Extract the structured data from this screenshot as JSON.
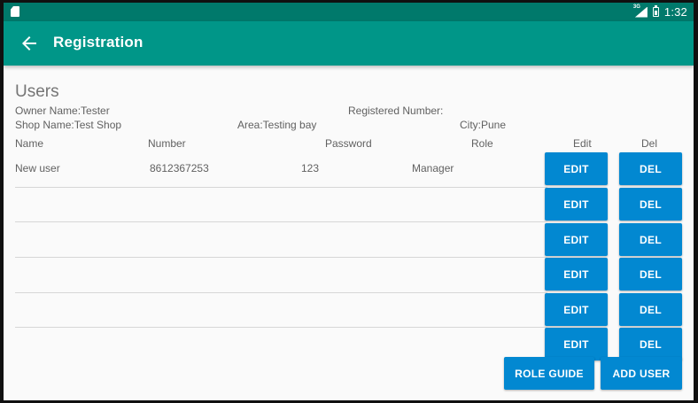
{
  "status_bar": {
    "network": "3G",
    "time": "1:32"
  },
  "app_bar": {
    "title": "Registration"
  },
  "section": {
    "title": "Users"
  },
  "shop_info": {
    "owner": "Owner Name:Tester",
    "registered_number": "Registered Number:",
    "shop_name": "Shop Name:Test Shop",
    "area": "Area:Testing bay",
    "city": "City:Pune"
  },
  "table": {
    "columns": {
      "name": "Name",
      "number": "Number",
      "password": "Password",
      "role": "Role",
      "edit": "Edit",
      "del": "Del"
    },
    "rows": [
      {
        "name": "New user",
        "number": "8612367253",
        "password": "123",
        "role": "Manager",
        "edit_label": "EDIT",
        "del_label": "DEL"
      },
      {
        "name": "",
        "number": "",
        "password": "",
        "role": "",
        "edit_label": "EDIT",
        "del_label": "DEL"
      },
      {
        "name": "",
        "number": "",
        "password": "",
        "role": "",
        "edit_label": "EDIT",
        "del_label": "DEL"
      },
      {
        "name": "",
        "number": "",
        "password": "",
        "role": "",
        "edit_label": "EDIT",
        "del_label": "DEL"
      },
      {
        "name": "",
        "number": "",
        "password": "",
        "role": "",
        "edit_label": "EDIT",
        "del_label": "DEL"
      },
      {
        "name": "",
        "number": "",
        "password": "",
        "role": "",
        "edit_label": "EDIT",
        "del_label": "DEL"
      }
    ]
  },
  "actions": {
    "role_guide": "ROLE GUIDE",
    "add_user": "ADD USER"
  },
  "colors": {
    "status_bar": "#00796b",
    "app_bar": "#009688",
    "button": "#0288d1"
  }
}
